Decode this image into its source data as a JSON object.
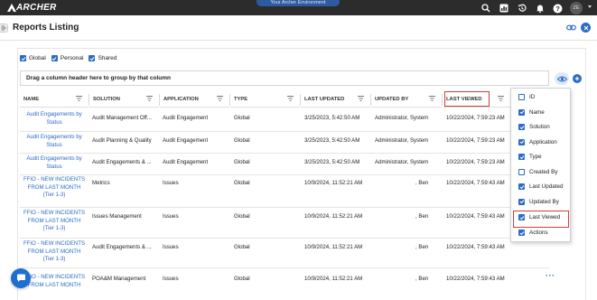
{
  "topbar": {
    "logo": "ARCHER",
    "environment_badge": "Your Archer Environment",
    "avatar_initials": "ZE",
    "icons": [
      "search-icon",
      "reports-icon",
      "history-icon",
      "notification-icon",
      "help-icon"
    ]
  },
  "page": {
    "title": "Reports Listing"
  },
  "filters": [
    {
      "label": "Global",
      "checked": true
    },
    {
      "label": "Personal",
      "checked": true
    },
    {
      "label": "Shared",
      "checked": true
    }
  ],
  "grouping": {
    "placeholder": "Drag a column header here to group by that column"
  },
  "columns": [
    "NAME",
    "SOLUTION",
    "APPLICATION",
    "TYPE",
    "LAST UPDATED",
    "UPDATED BY",
    "LAST VIEWED"
  ],
  "rows": [
    {
      "name": "Audit Engagements by Status",
      "solution": "Audit Management Off...",
      "application": "Audit Engagement",
      "type": "Global",
      "last_updated": "3/25/2023, 5:42:50 AM",
      "updated_by": "Administrator, System",
      "last_viewed": "10/22/2024, 7:59:23 AM"
    },
    {
      "name": "Audit Engagements by Status",
      "solution": "Audit Planning & Quality",
      "application": "Audit Engagement",
      "type": "Global",
      "last_updated": "3/25/2023, 5:42:50 AM",
      "updated_by": "Administrator, System",
      "last_viewed": "10/22/2024, 7:59:23 AM"
    },
    {
      "name": "Audit Engagements by Status",
      "solution": "Audit Engagements & ...",
      "application": "Audit Engagement",
      "type": "Global",
      "last_updated": "3/25/2023, 5:42:50 AM",
      "updated_by": "Administrator, System",
      "last_viewed": "10/22/2024, 7:59:23 AM"
    },
    {
      "name": "FFIO - NEW INCIDENTS FROM LAST MONTH (Tier 1-3)",
      "solution": "Metrics",
      "application": "Issues",
      "type": "Global",
      "last_updated": "10/9/2024, 11:52:21 AM",
      "updated_by": ", Ben",
      "last_viewed": "10/22/2024, 7:59:43 AM"
    },
    {
      "name": "FFIO - NEW INCIDENTS FROM LAST MONTH (Tier 1-3)",
      "solution": "Issues Management",
      "application": "Issues",
      "type": "Global",
      "last_updated": "10/9/2024, 11:52:21 AM",
      "updated_by": ", Ben",
      "last_viewed": "10/22/2024, 7:59:43 AM"
    },
    {
      "name": "FFIO - NEW INCIDENTS FROM LAST MONTH (Tier 1-3)",
      "solution": "Audit Engagements & ...",
      "application": "Issues",
      "type": "Global",
      "last_updated": "10/9/2024, 11:52:21 AM",
      "updated_by": ", Ben",
      "last_viewed": "10/22/2024, 7:59:43 AM"
    },
    {
      "name": "FFIO - NEW INCIDENTS FROM LAST MONTH",
      "solution": "POA&M Management",
      "application": "Issues",
      "type": "Global",
      "last_updated": "10/9/2024, 11:52:21 AM",
      "updated_by": ", Ben",
      "last_viewed": "10/22/2024, 7:59:43 AM"
    }
  ],
  "column_chooser": [
    {
      "label": "ID",
      "checked": false
    },
    {
      "label": "Name",
      "checked": true
    },
    {
      "label": "Solution",
      "checked": true
    },
    {
      "label": "Application",
      "checked": true
    },
    {
      "label": "Type",
      "checked": true
    },
    {
      "label": "Created By",
      "checked": false
    },
    {
      "label": "Last Updated",
      "checked": true
    },
    {
      "label": "Updated By",
      "checked": true
    },
    {
      "label": "Last Viewed",
      "checked": true
    },
    {
      "label": "Actions",
      "checked": true
    }
  ],
  "colors": {
    "topbar": "#2c2c2c",
    "accent": "#2b6cc4",
    "highlight": "#d63a3a",
    "link": "#2b6cc4"
  }
}
